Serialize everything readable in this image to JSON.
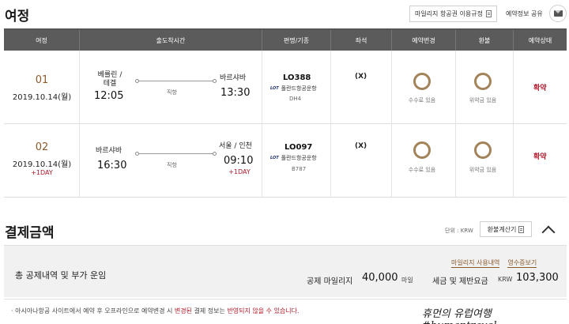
{
  "header": {
    "title": "여정",
    "policy_button": "마일리지 항공권 이용규정",
    "share_label": "예약정보 공유"
  },
  "table": {
    "columns": [
      "여정",
      "출도착시간",
      "편명/기종",
      "좌석",
      "예약변경",
      "환불",
      "예약상태"
    ],
    "rows": [
      {
        "no": "01",
        "date": "2019.10.14(월)",
        "plus_day": "",
        "dep_city": "베를린 / 테겔",
        "dep_time": "12:05",
        "direct": "직항",
        "arr_city": "바르샤바",
        "arr_time": "13:30",
        "arr_plus": "",
        "flight": "LO388",
        "carrier": "폴란드항공운항",
        "aircraft": "DH4",
        "seat": "(X)",
        "change": "수수료 있음",
        "refund": "위약금 있음",
        "status": "확약"
      },
      {
        "no": "02",
        "date": "2019.10.14(월)",
        "plus_day": "+1DAY",
        "dep_city": "바르샤바",
        "dep_time": "16:30",
        "direct": "직항",
        "arr_city": "서울 / 인천",
        "arr_time": "09:10",
        "arr_plus": "+1DAY",
        "flight": "LO097",
        "carrier": "폴란드항공운항",
        "aircraft": "B787",
        "seat": "(X)",
        "change": "수수료 있음",
        "refund": "위약금 있음",
        "status": "확약"
      }
    ],
    "carrier_logo": "LOT"
  },
  "payment": {
    "title": "결제금액",
    "unit": "단위 : KRW",
    "calc_button": "환불계산기",
    "total_label": "총 공제내역 및 부가 운임",
    "link_mileage": "마일리지 사용내역",
    "link_receipt": "영수증보기",
    "mileage_label": "공제 마일리지",
    "mileage_value": "40,000",
    "mileage_unit": "마일",
    "tax_label": "세금 및 제반요금",
    "tax_currency": "KRW",
    "tax_value": "103,300"
  },
  "notice": {
    "pre": "아시아나항공 사이트에서 예약 후 오프라인으로 예약변경 시 ",
    "hl1": "변경된",
    "mid": " 결제 정보는 ",
    "hl2": "반영되지 않을 수 있습니다.",
    "bullet": "·"
  },
  "watermark": "휴먼의 유럽여행 #humantravel",
  "colors": {
    "accent": "#8a5a2b",
    "status": "#b0182a",
    "header_bg": "#5b5b5b"
  }
}
